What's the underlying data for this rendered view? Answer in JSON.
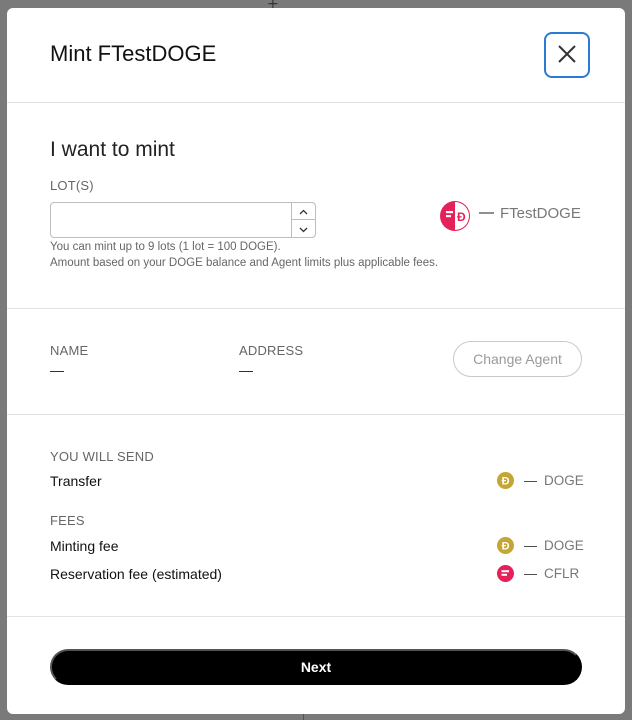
{
  "modal": {
    "title": "Mint FTestDOGE"
  },
  "mint": {
    "heading": "I want to mint",
    "lots_label": "LOT(S)",
    "lots_value": "",
    "hint_line1": "You can mint up to 9 lots (1 lot = 100 DOGE).",
    "hint_line2": "Amount based on your DOGE balance and Agent limits plus applicable fees.",
    "output_amount": "—",
    "output_token": "FTestDOGE",
    "output_token_icon": "fasset-doge-icon"
  },
  "agent": {
    "name_label": "NAME",
    "name_value": "—",
    "address_label": "ADDRESS",
    "address_value": "—",
    "change_label": "Change Agent"
  },
  "send": {
    "heading": "YOU WILL SEND",
    "transfer_label": "Transfer",
    "transfer_amount": "—",
    "transfer_unit": "DOGE",
    "fees_heading": "FEES",
    "minting_fee_label": "Minting fee",
    "minting_fee_amount": "—",
    "minting_fee_unit": "DOGE",
    "reservation_fee_label": "Reservation fee (estimated)",
    "reservation_fee_amount": "—",
    "reservation_fee_unit": "CFLR"
  },
  "footer": {
    "next_label": "Next"
  },
  "colors": {
    "doge": "#c3a634",
    "flare": "#e62058",
    "focus": "#2b7bd6"
  }
}
